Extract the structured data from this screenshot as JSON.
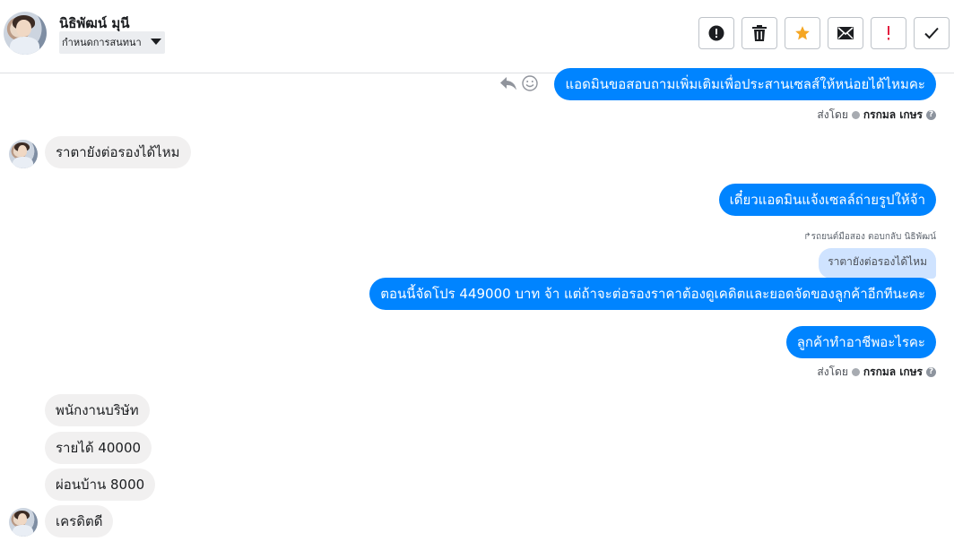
{
  "header": {
    "contact_name": "นิธิพัฒน์ มุนี",
    "conversation_tag": "กำหนดการสนทนา",
    "actions": [
      {
        "icon": "alert-circle-icon",
        "name": "mark-spam-button"
      },
      {
        "icon": "trash-icon",
        "name": "delete-button"
      },
      {
        "icon": "star-icon",
        "name": "star-button"
      },
      {
        "icon": "envelope-icon",
        "name": "mark-unread-button"
      },
      {
        "icon": "exclamation-icon",
        "name": "follow-up-button"
      },
      {
        "icon": "checkmark-icon",
        "name": "done-button"
      }
    ]
  },
  "messages": {
    "m1": "แอดมินขอสอบถามเพิ่มเติมเพื่อประสานเซลส์ให้หน่อยได้ไหมคะ",
    "sent_by_label": "ส่งโดย",
    "sent_by_name": "กรกมล เกษร",
    "help_mark": "?",
    "m2": "ราตายังต่อรองได้ไหม",
    "m3": "เดี๋ยวแอดมินแจ้งเซลล์ถ่ายรูปให้จ้า",
    "reply_note": "↱รถยนต์มือสอง ตอบกลับ นิธิพัฒน์",
    "quoted": "ราตายังต่อรองได้ไหม",
    "m4": "ตอนนี้จัดโปร 449000 บาท จ้า แต่ถ้าจะต่อรองราคาต้องดูเคดิตและยอดจัดของลูกค้าอีกทีนะคะ",
    "m5": "ลูกค้าทำอาชีพอะไรคะ",
    "m6": "พนักงานบริษัท",
    "m7": "รายได้ 40000",
    "m8": "ผ่อนบ้าน 8000",
    "m9": "เครดิตดี"
  },
  "colors": {
    "outgoing": "#0084ff",
    "incoming": "#f1f0f0",
    "quote": "#cfe3ff",
    "star": "#f5a623",
    "alert": "#e41e3f"
  }
}
